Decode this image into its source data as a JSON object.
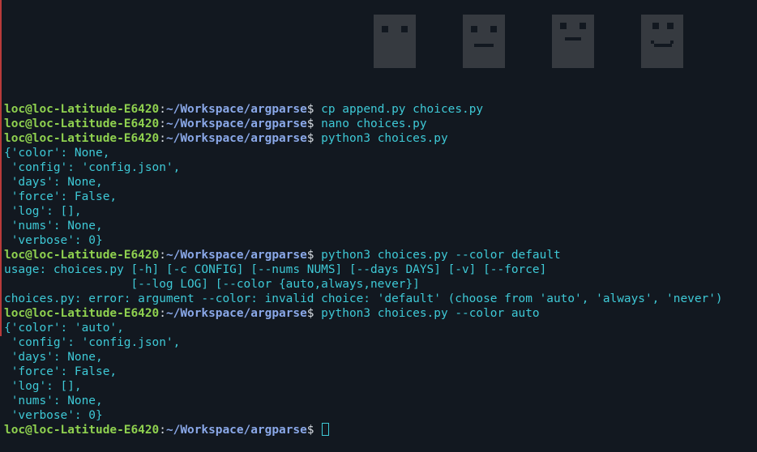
{
  "prompt": {
    "user_host": "loc@loc-Latitude-E6420",
    "separator": ":",
    "path": "~/Workspace/argparse",
    "dollar": "$ "
  },
  "colors": {
    "background": "#121820",
    "text": "#3ec9d6",
    "prompt_user": "#8fd14f",
    "prompt_path": "#8aa8e8",
    "left_border": "#b83a3a"
  },
  "lines": [
    {
      "type": "prompt",
      "command": "cp append.py choices.py"
    },
    {
      "type": "prompt",
      "command": "nano choices.py"
    },
    {
      "type": "prompt",
      "command": "python3 choices.py"
    },
    {
      "type": "output",
      "text": "{'color': None,"
    },
    {
      "type": "output",
      "text": " 'config': 'config.json',"
    },
    {
      "type": "output",
      "text": " 'days': None,"
    },
    {
      "type": "output",
      "text": " 'force': False,"
    },
    {
      "type": "output",
      "text": " 'log': [],"
    },
    {
      "type": "output",
      "text": " 'nums': None,"
    },
    {
      "type": "output",
      "text": " 'verbose': 0}"
    },
    {
      "type": "prompt",
      "command": "python3 choices.py --color default"
    },
    {
      "type": "output",
      "text": "usage: choices.py [-h] [-c CONFIG] [--nums NUMS] [--days DAYS] [-v] [--force]"
    },
    {
      "type": "output",
      "text": "                  [--log LOG] [--color {auto,always,never}]"
    },
    {
      "type": "output",
      "text": "choices.py: error: argument --color: invalid choice: 'default' (choose from 'auto', 'always', 'never')"
    },
    {
      "type": "prompt",
      "command": "python3 choices.py --color auto"
    },
    {
      "type": "output",
      "text": "{'color': 'auto',"
    },
    {
      "type": "output",
      "text": " 'config': 'config.json',"
    },
    {
      "type": "output",
      "text": " 'days': None,"
    },
    {
      "type": "output",
      "text": " 'force': False,"
    },
    {
      "type": "output",
      "text": " 'log': [],"
    },
    {
      "type": "output",
      "text": " 'nums': None,"
    },
    {
      "type": "output",
      "text": " 'verbose': 0}"
    },
    {
      "type": "prompt",
      "command": "",
      "cursor": true
    }
  ],
  "background_art": [
    "face-icon",
    "sad-face-icon",
    "neutral-face-icon",
    "happy-face-icon"
  ]
}
